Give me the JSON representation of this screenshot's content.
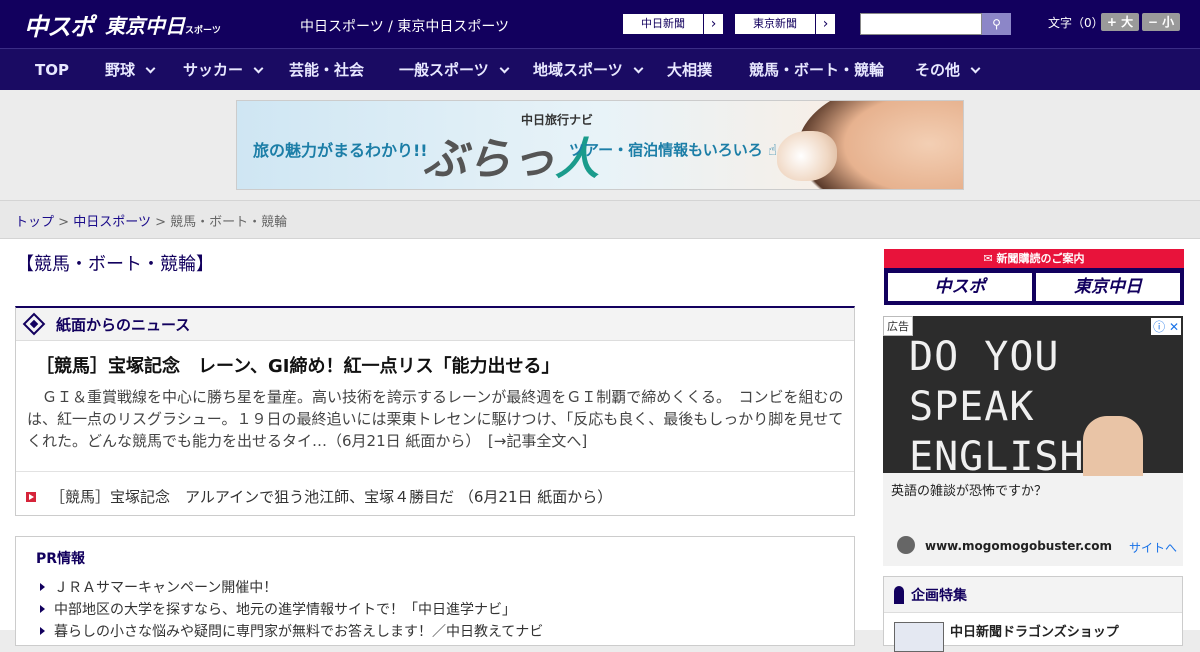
{
  "header": {
    "logo_chuspo": "中スポ",
    "logo_tokyo": "東京中日",
    "logo_tokyo_small": "スポーツ",
    "site_title": "中日スポーツ / 東京中日スポーツ",
    "ext_links": [
      "中日新聞",
      "東京新聞"
    ],
    "font_size_label": "文字（0）",
    "font_bigger": "+ 大",
    "font_smaller": "− 小"
  },
  "nav": {
    "items": [
      {
        "label": "TOP"
      },
      {
        "label": "野球"
      },
      {
        "label": "サッカー"
      },
      {
        "label": "芸能・社会"
      },
      {
        "label": "一般スポーツ"
      },
      {
        "label": "地域スポーツ"
      },
      {
        "label": "大相撲"
      },
      {
        "label": "競馬・ボート・競輪"
      },
      {
        "label": "その他"
      }
    ]
  },
  "banner": {
    "lead": "旅の魅力がまるわかり!!",
    "brand_small": "中日旅行ナビ",
    "brand_main_1": "ぶらっ",
    "brand_main_2": "人",
    "tail": "ツアー・宿泊情報もいろいろ"
  },
  "breadcrumb": {
    "home": "トップ",
    "section": "中日スポーツ",
    "current": "競馬・ボート・競輪",
    "sep": ">"
  },
  "main": {
    "heading": "【競馬・ボート・競輪】",
    "news_section_title": "紙面からのニュース",
    "lead_title": "［競馬］宝塚記念　レーン、GI締め！紅一点リス「能力出せる」",
    "lead_body": "ＧＩ＆重賞戦線を中心に勝ち星を量産。高い技術を誇示するレーンが最終週をＧＩ制覇で締めくくる。　コンビを組むのは、紅一点のリスグラシュー。１９日の最終追いには栗東トレセンに駆けつけ、「反応も良く、最後もしっかり脚を見せてくれた。どんな競馬でも能力を出せるタイ…（6月21日 紙面から）　[→記事全文へ]",
    "sub_link": "［競馬］宝塚記念　アルアインで狙う池江師、宝塚４勝目だ （6月21日 紙面から）",
    "pr_title": "PR情報",
    "pr_items": [
      "ＪＲＡサマーキャンペーン開催中！",
      "中部地区の大学を探すなら、地元の進学情報サイトで！「中日進学ナビ」",
      "暮らしの小さな悩みや疑問に専門家が無料でお答えします！／中日教えてナビ"
    ]
  },
  "sidebar": {
    "subscribe_title": "新聞購読のご案内",
    "subscribe_buttons": [
      "中スポ",
      "東京中日"
    ],
    "ad_tag": "広告",
    "ad_icons": "ⓘ ✕",
    "ad_image_text_1": "DO YOU SPEAK",
    "ad_image_text_2": "ENGLISH ?",
    "ad_text": "英語の雑談が恐怖ですか？",
    "ad_url": "www.mogomogobuster.com",
    "ad_link": "サイトへ",
    "feature_title": "企画特集",
    "feature_item": "中日新聞ドラゴンズショップ"
  },
  "colors": {
    "header_bg": "#12005e",
    "nav_bg": "#1a0b63",
    "accent_red": "#e8133b",
    "link_blue": "#1a0b8a"
  }
}
